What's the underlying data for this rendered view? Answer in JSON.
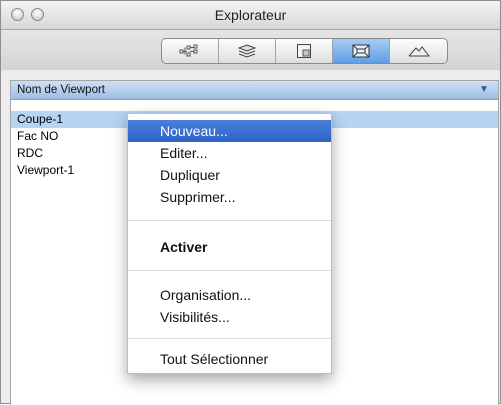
{
  "window": {
    "title": "Explorateur"
  },
  "toolbar": {
    "buttons": [
      {
        "icon": "hierarchy-icon"
      },
      {
        "icon": "layers-icon"
      },
      {
        "icon": "sheet-icon"
      },
      {
        "icon": "viewport-icon"
      },
      {
        "icon": "terrain-icon"
      }
    ],
    "active_index": 3
  },
  "list": {
    "column_header": "Nom de Viewport",
    "sort_indicator": "▼",
    "items": [
      "Coupe-1",
      "Fac NO",
      "RDC",
      "Viewport-1"
    ],
    "selected_index": 0
  },
  "context_menu": {
    "groups": [
      [
        "Nouveau...",
        "Editer...",
        "Dupliquer",
        "Supprimer..."
      ],
      [
        "Activer"
      ],
      [
        "Organisation...",
        "Visibilités..."
      ],
      [
        "Tout Sélectionner"
      ]
    ],
    "highlighted": "Nouveau..."
  },
  "colors": {
    "selection": "#b7d4f3",
    "menu_highlight": "#2f62c7",
    "header": "#9cbde4"
  }
}
